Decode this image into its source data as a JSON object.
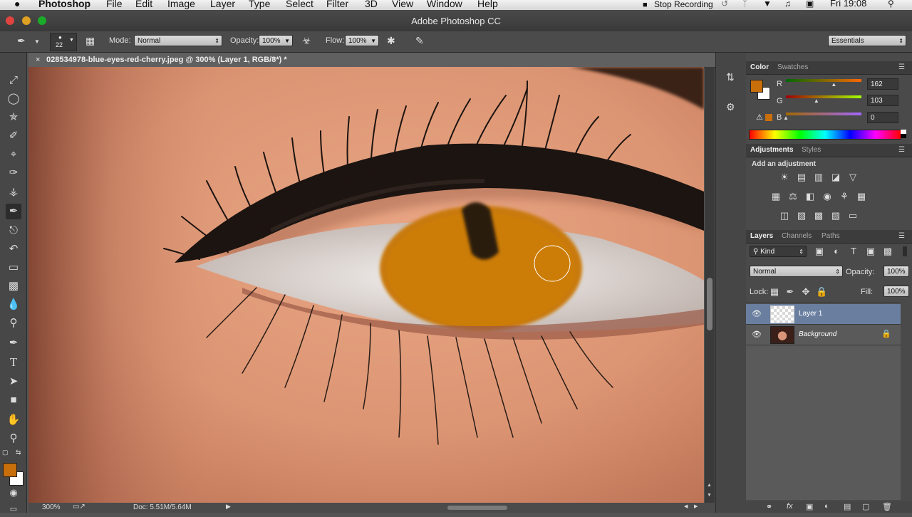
{
  "menubar": {
    "apple": "",
    "app": "Photoshop",
    "items": [
      "File",
      "Edit",
      "Image",
      "Layer",
      "Type",
      "Select",
      "Filter",
      "3D",
      "View",
      "Window",
      "Help"
    ],
    "stop_recording": "Stop Recording",
    "clock": "Fri 19:08"
  },
  "window": {
    "title": "Adobe Photoshop CC"
  },
  "options": {
    "brush_size": "22",
    "mode_label": "Mode:",
    "mode_value": "Normal",
    "opacity_label": "Opacity:",
    "opacity_value": "100%",
    "flow_label": "Flow:",
    "flow_value": "100%",
    "workspace": "Essentials"
  },
  "document": {
    "tab_title": "028534978-blue-eyes-red-cherry.jpeg @ 300% (Layer 1, RGB/8*) *",
    "zoom": "300%",
    "doc_size": "Doc: 5.51M/5.64M"
  },
  "colors": {
    "foreground": "#c86e0a",
    "background": "#ffffff",
    "accent": "#6a7fa0"
  },
  "color_panel": {
    "tabs": [
      "Color",
      "Swatches"
    ],
    "r_label": "R",
    "g_label": "G",
    "b_label": "B",
    "r": "162",
    "g": "103",
    "b": "0"
  },
  "adjustments_panel": {
    "tabs": [
      "Adjustments",
      "Styles"
    ],
    "heading": "Add an adjustment"
  },
  "layers_panel": {
    "tabs": [
      "Layers",
      "Channels",
      "Paths"
    ],
    "filter": "Kind",
    "blend_mode": "Normal",
    "opacity_label": "Opacity:",
    "opacity_value": "100%",
    "lock_label": "Lock:",
    "fill_label": "Fill:",
    "fill_value": "100%",
    "layers": [
      {
        "name": "Layer 1"
      },
      {
        "name": "Background"
      }
    ]
  }
}
